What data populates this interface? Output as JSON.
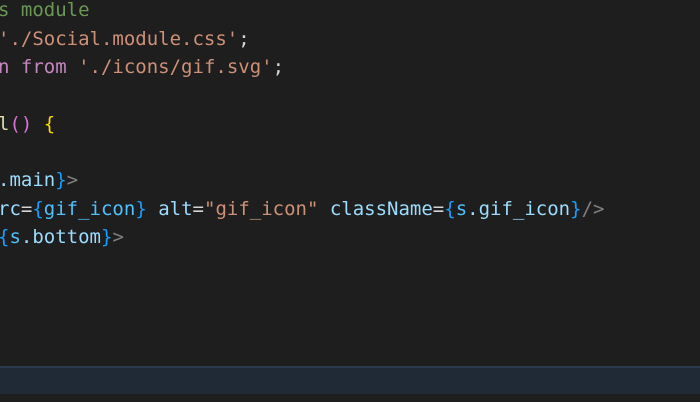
{
  "editor": {
    "lines": [
      [
        {
          "t": "s module",
          "c": "comment"
        }
      ],
      [
        {
          "t": "'./Social.module.css'",
          "c": "string"
        },
        {
          "t": ";",
          "c": "punct"
        }
      ],
      [
        {
          "t": "n ",
          "c": "keyword"
        },
        {
          "t": "from",
          "c": "keyword"
        },
        {
          "t": " ",
          "c": "punct"
        },
        {
          "t": "'./icons/gif.svg'",
          "c": "string"
        },
        {
          "t": ";",
          "c": "punct"
        }
      ],
      [],
      [
        {
          "t": "l",
          "c": "func"
        },
        {
          "t": "()",
          "c": "paren"
        },
        {
          "t": " ",
          "c": "punct"
        },
        {
          "t": "{",
          "c": "brace-gold"
        }
      ],
      [],
      [
        {
          "t": ".main",
          "c": "prop"
        },
        {
          "t": "}",
          "c": "brace-blue"
        },
        {
          "t": ">",
          "c": "tag-punct"
        }
      ],
      [
        {
          "t": "rc",
          "c": "attr"
        },
        {
          "t": "=",
          "c": "punct"
        },
        {
          "t": "{",
          "c": "brace-blue"
        },
        {
          "t": "gif_icon",
          "c": "var"
        },
        {
          "t": "}",
          "c": "brace-blue"
        },
        {
          "t": " ",
          "c": "punct"
        },
        {
          "t": "alt",
          "c": "attr"
        },
        {
          "t": "=",
          "c": "punct"
        },
        {
          "t": "\"gif_icon\"",
          "c": "string"
        },
        {
          "t": " ",
          "c": "punct"
        },
        {
          "t": "className",
          "c": "attr"
        },
        {
          "t": "=",
          "c": "punct"
        },
        {
          "t": "{",
          "c": "brace-blue"
        },
        {
          "t": "s",
          "c": "var"
        },
        {
          "t": ".gif_icon",
          "c": "prop"
        },
        {
          "t": "}",
          "c": "brace-blue"
        },
        {
          "t": "/>",
          "c": "tag-punct"
        }
      ],
      [
        {
          "t": "{",
          "c": "brace-blue"
        },
        {
          "t": "s",
          "c": "var"
        },
        {
          "t": ".bottom",
          "c": "prop"
        },
        {
          "t": "}",
          "c": "brace-blue"
        },
        {
          "t": ">",
          "c": "tag-punct"
        }
      ]
    ]
  },
  "colors": {
    "background": "#1e1e1e",
    "comment": "#6a9955",
    "string": "#ce9178",
    "keyword": "#c586c0",
    "variable": "#4fc1ff",
    "property": "#9cdcfe",
    "brace_gold": "#ffd700",
    "brace_blue": "#179fff",
    "tag_punct": "#808080"
  }
}
